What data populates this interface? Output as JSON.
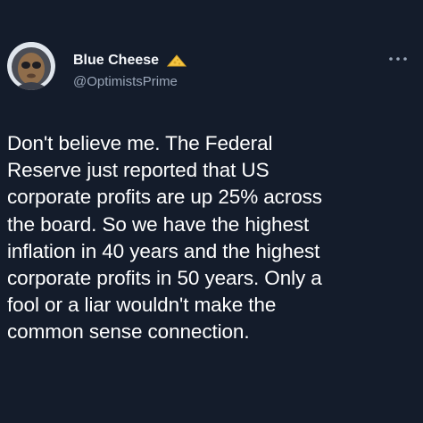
{
  "author": {
    "display_name": "Blue Cheese",
    "handle": "@OptimistsPrime",
    "emoji_icon": "cheese-wedge-icon",
    "avatar_icon": "alien-portrait-avatar"
  },
  "actions": {
    "more_icon": "more-options-icon"
  },
  "tweet": {
    "lines": [
      "Don't believe me. The Federal",
      "Reserve just reported that US",
      "corporate profits are up 25% across",
      "the board. So we have the highest",
      "inflation in 40 years and the highest",
      "corporate profits in 50 years. Only a",
      "fool or a liar wouldn't make the",
      "common sense connection."
    ]
  },
  "colors": {
    "background": "#141c2b",
    "text_primary": "#ffffff",
    "text_secondary": "#9aa6b8",
    "cheese": "#f5c542"
  }
}
